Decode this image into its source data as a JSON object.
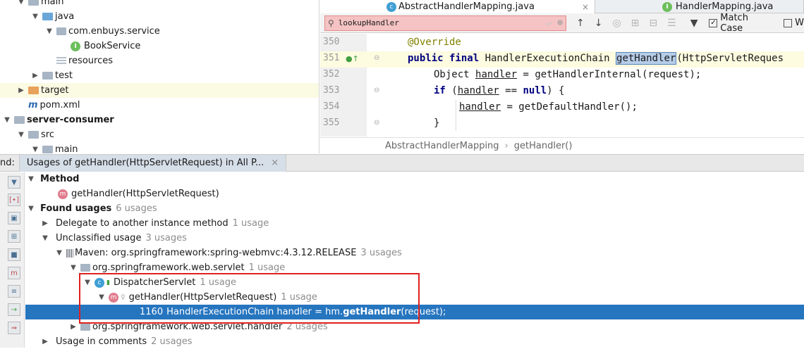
{
  "project_tree": [
    {
      "label": "main",
      "indent": 1,
      "expanded": true,
      "icon": "folder",
      "bold": false
    },
    {
      "label": "java",
      "indent": 2,
      "expanded": true,
      "icon": "folder-blue",
      "bold": false
    },
    {
      "label": "com.enbuys.service",
      "indent": 3,
      "expanded": true,
      "icon": "package",
      "bold": false
    },
    {
      "label": "BookService",
      "indent": 4,
      "expanded": null,
      "icon": "interface",
      "bold": false
    },
    {
      "label": "resources",
      "indent": 3,
      "expanded": null,
      "icon": "resources",
      "bold": false
    },
    {
      "label": "test",
      "indent": 2,
      "expanded": false,
      "icon": "folder",
      "bold": false
    },
    {
      "label": "target",
      "indent": 1,
      "expanded": false,
      "icon": "folder-orange",
      "bold": false
    },
    {
      "label": "pom.xml",
      "indent": 1,
      "expanded": null,
      "icon": "maven",
      "bold": false
    },
    {
      "label": "server-consumer",
      "indent": 0,
      "expanded": true,
      "icon": "folder",
      "bold": true
    },
    {
      "label": "src",
      "indent": 1,
      "expanded": true,
      "icon": "folder",
      "bold": false
    },
    {
      "label": "main",
      "indent": 2,
      "expanded": true,
      "icon": "folder",
      "bold": false
    }
  ],
  "editor": {
    "tabs": [
      {
        "label": "AbstractHandlerMapping.java",
        "icon": "class-icon",
        "active": true
      },
      {
        "label": "HandlerMapping.java",
        "icon": "interface-icon",
        "active": false
      }
    ],
    "find": {
      "query": "lookupHandler",
      "match_case_label": "Match Case",
      "words_label": "W"
    },
    "lines": [
      {
        "num": "350"
      },
      {
        "num": "351"
      },
      {
        "num": "352"
      },
      {
        "num": "353"
      },
      {
        "num": "354"
      },
      {
        "num": "355"
      }
    ],
    "code": {
      "l350": "@Override",
      "l351_kw": "public final ",
      "l351_type": "HandlerExecutionChain ",
      "l351_name": "getHandler",
      "l351_rest": "(HttpServletReques",
      "l352_a": "Object ",
      "l352_var": "handler",
      "l352_b": " = getHandlerInternal(request);",
      "l353_kw": "if",
      "l353_a": " (",
      "l353_var": "handler",
      "l353_b": " == ",
      "l353_null": "null",
      "l353_c": ") {",
      "l354_var": "handler",
      "l354_b": " = getDefaultHandler();",
      "l355": "}"
    },
    "breadcrumb": {
      "class": "AbstractHandlerMapping",
      "sep": "›",
      "method": "getHandler()"
    }
  },
  "find_window": {
    "header_label": "nd:",
    "tab_label": "Usages of getHandler(HttpServletRequest) in All P...",
    "rows": {
      "method_hdr": "Method",
      "method": "getHandler(HttpServletRequest)",
      "found": "Found usages",
      "found_count": "6 usages",
      "delegate": "Delegate to another instance method",
      "delegate_count": "1 usage",
      "unclassified": "Unclassified usage",
      "unclassified_count": "3 usages",
      "maven": "Maven: org.springframework:spring-webmvc:4.3.12.RELEASE",
      "maven_count": "3 usages",
      "pkg": "org.springframework.web.servlet",
      "pkg_count": "1 usage",
      "cls": "DispatcherServlet",
      "cls_count": "1 usage",
      "m2": "getHandler(HttpServletRequest)",
      "m2_count": "1 usage",
      "hit_line": "1160",
      "hit_a": "HandlerExecutionChain handler = hm.",
      "hit_b": "getHandler",
      "hit_c": "(request);",
      "pkg2": "org.springframework.web.servlet.handler",
      "pkg2_count": "2 usages",
      "comments": "Usage in comments",
      "comments_count": "2 usages"
    }
  }
}
